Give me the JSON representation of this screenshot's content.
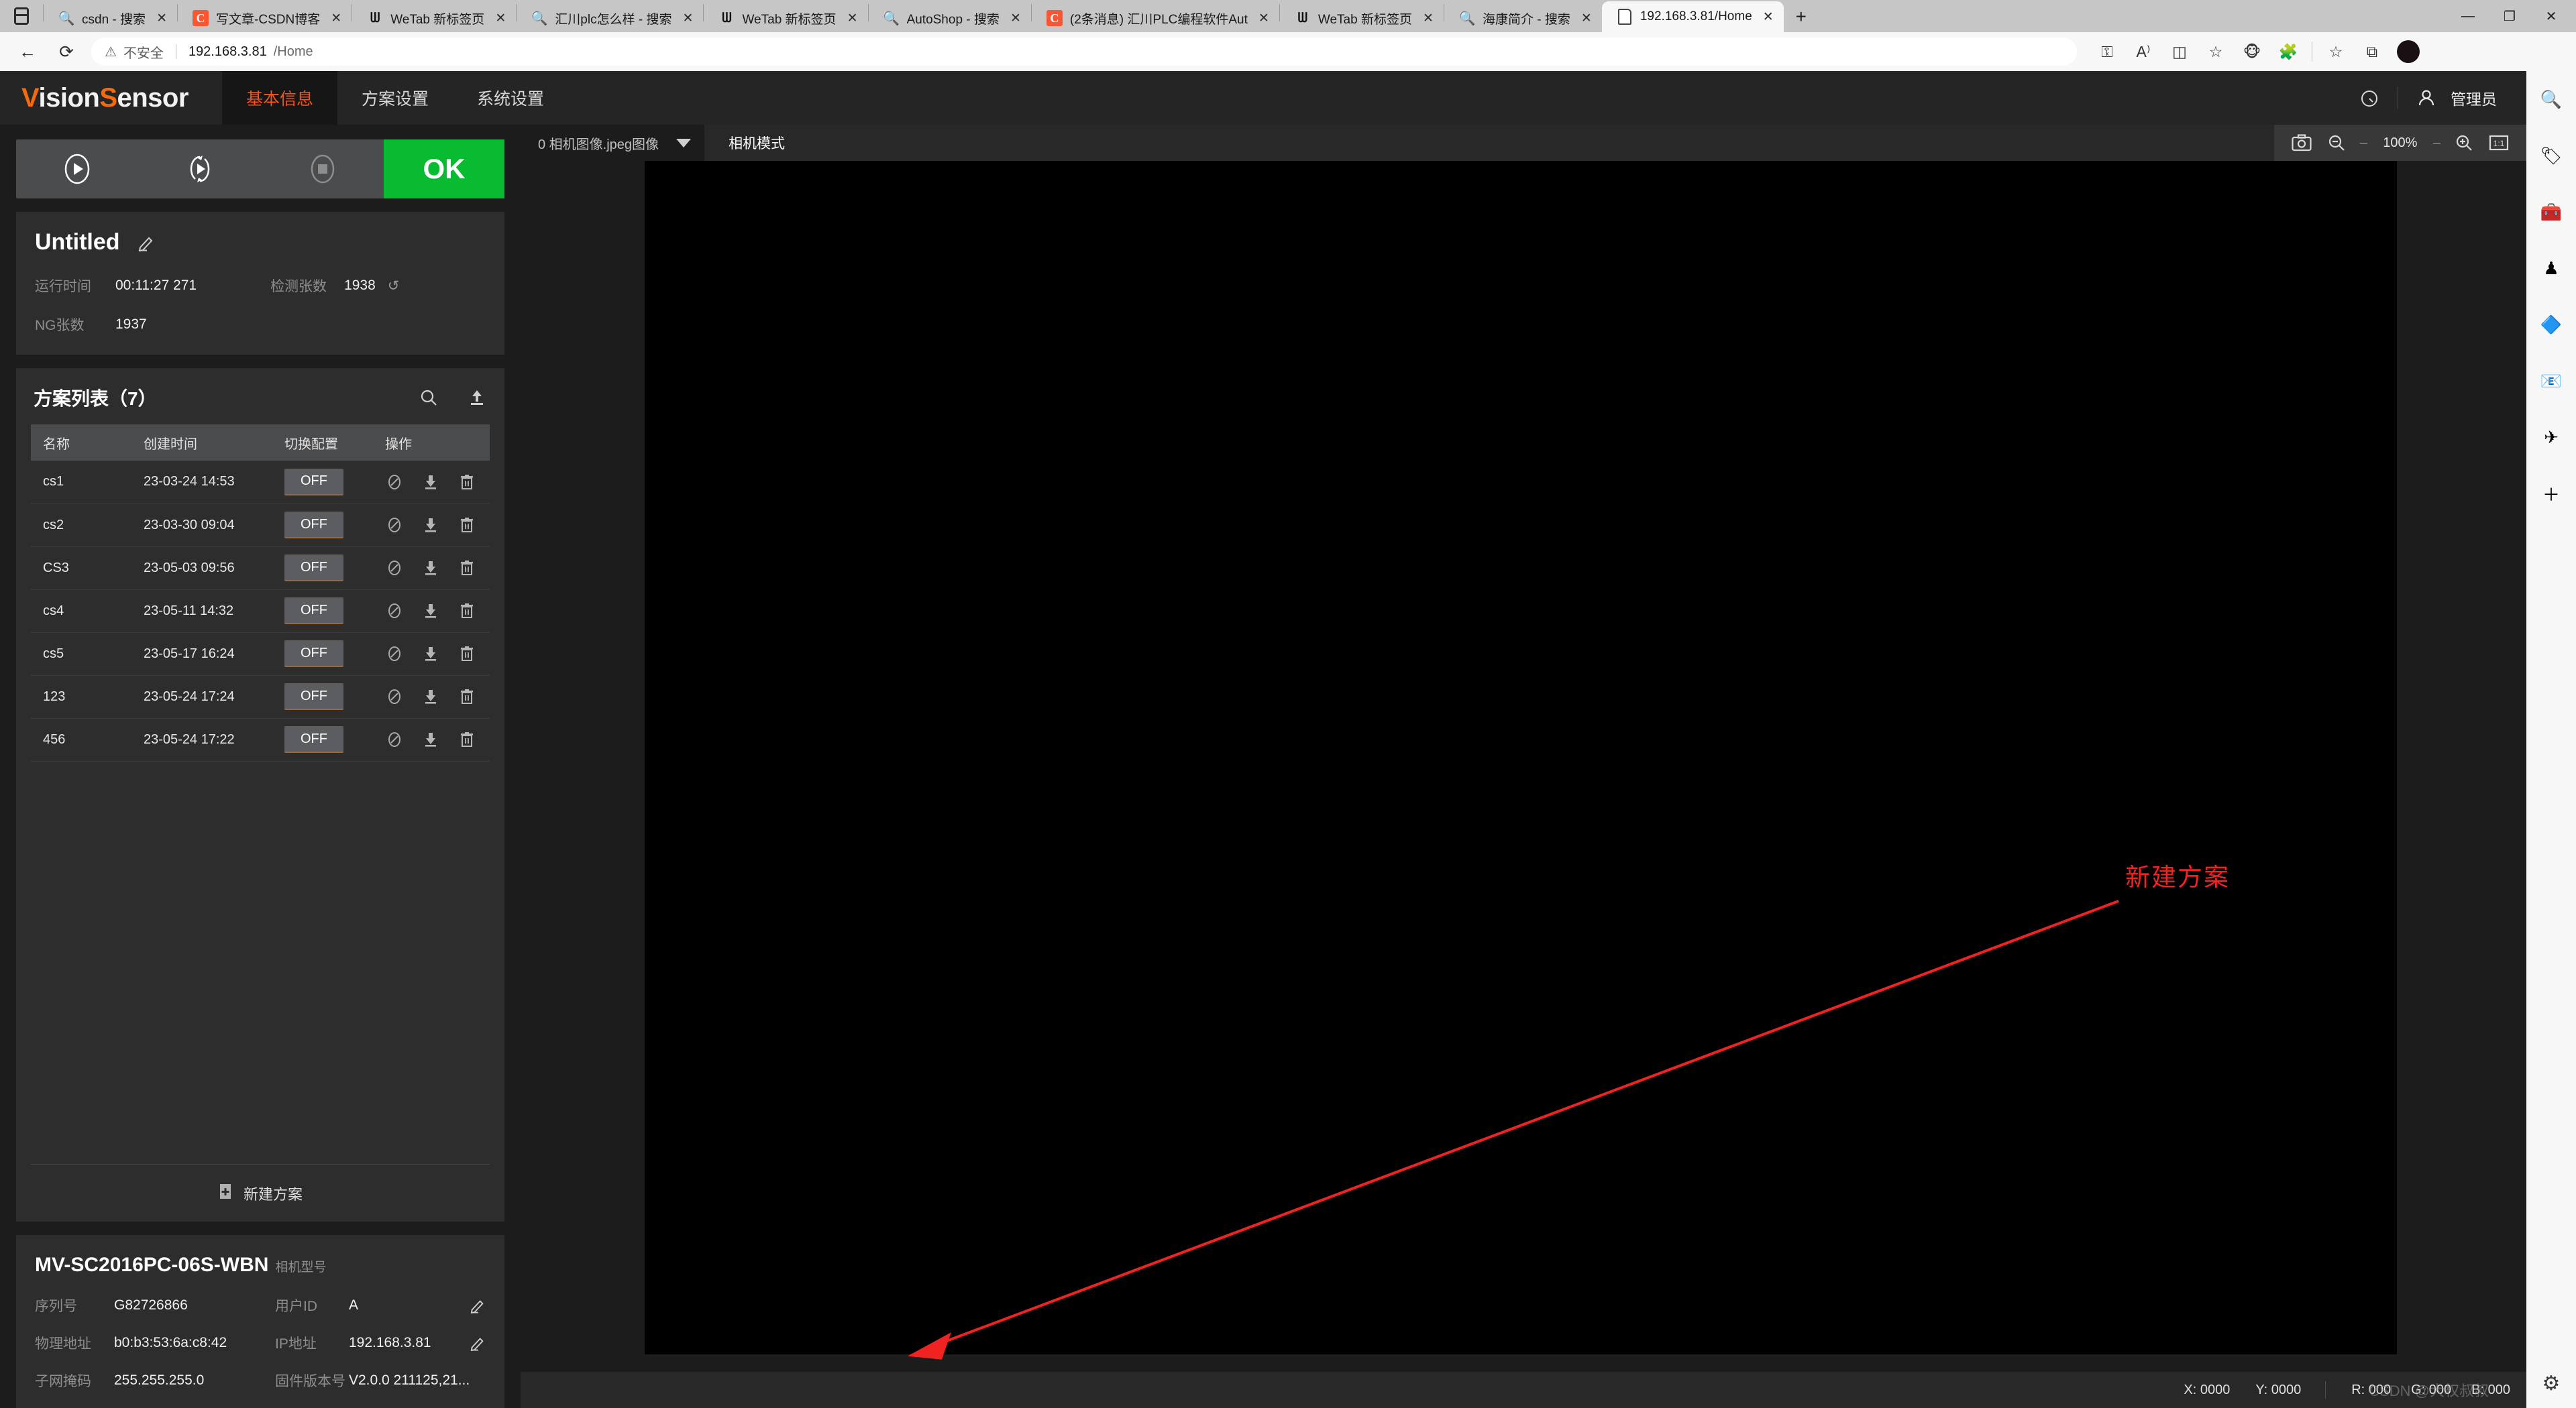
{
  "browser": {
    "tabs": [
      {
        "title": "csdn - 搜索",
        "favicon": "search-icon",
        "active": false
      },
      {
        "title": "写文章-CSDN博客",
        "favicon": "csdn-icon",
        "active": false
      },
      {
        "title": "WeTab 新标签页",
        "favicon": "wetab-icon",
        "active": false
      },
      {
        "title": "汇川plc怎么样 - 搜索",
        "favicon": "search-icon",
        "active": false
      },
      {
        "title": "WeTab 新标签页",
        "favicon": "wetab-icon",
        "active": false
      },
      {
        "title": "AutoShop - 搜索",
        "favicon": "search-icon",
        "active": false
      },
      {
        "title": "(2条消息) 汇川PLC编程软件Aut",
        "favicon": "csdn-icon",
        "active": false
      },
      {
        "title": "WeTab 新标签页",
        "favicon": "wetab-icon",
        "active": false
      },
      {
        "title": "海康简介 - 搜索",
        "favicon": "search-icon",
        "active": false
      },
      {
        "title": "192.168.3.81/Home",
        "favicon": "page-icon",
        "active": true
      }
    ],
    "new_tab_label": "+",
    "window_controls": {
      "minimize": "—",
      "maximize": "❐",
      "close": "✕"
    },
    "toolbar": {
      "back": "←",
      "reload": "⟳",
      "security_label": "不安全",
      "url_host": "192.168.3.81",
      "url_path": "/Home",
      "icons": [
        "key-icon",
        "read-aloud-icon",
        "split-screen-icon",
        "add-favorite-icon",
        "monkey-extension-icon",
        "extensions-icon",
        "favorites-icon",
        "collections-icon",
        "profile-avatar"
      ]
    },
    "sidebar_icons": [
      "search-icon",
      "shopping-tag-icon",
      "tools-icon",
      "games-icon",
      "office-icon",
      "outlook-icon",
      "telegram-icon",
      "add-icon"
    ],
    "settings_fab": "gear-icon"
  },
  "app": {
    "logo": {
      "orange_v": "V",
      "white_ision": "ision",
      "orange_s": "S",
      "white_ensor": "ensor"
    },
    "nav_tabs": [
      {
        "label": "基本信息",
        "active": true
      },
      {
        "label": "方案设置",
        "active": false
      },
      {
        "label": "系统设置",
        "active": false
      }
    ],
    "header_right": {
      "gauge_icon": "gauge-icon",
      "user_icon": "user-icon",
      "user_label": "管理员"
    },
    "run_controls": {
      "single_run": "play-circle-icon",
      "continuous_run": "play-loop-icon",
      "stop": "stop-circle-icon",
      "status_label": "OK",
      "status_color": "#09bb31"
    },
    "info_card": {
      "title": "Untitled",
      "edit_icon": "pencil-icon",
      "runtime_label": "运行时间",
      "runtime_value": "00:11:27 271",
      "detect_label": "检测张数",
      "detect_value": "1938",
      "reset_icon": "reset-icon",
      "ng_label": "NG张数",
      "ng_value": "1937"
    },
    "scheme_list": {
      "title": "方案列表（7）",
      "search_icon": "search-icon",
      "import_icon": "upload-icon",
      "columns": [
        "名称",
        "创建时间",
        "切换配置",
        "操作"
      ],
      "rows": [
        {
          "name": "cs1",
          "created": "23-03-24 14:53",
          "switch": "OFF"
        },
        {
          "name": "cs2",
          "created": "23-03-30 09:04",
          "switch": "OFF"
        },
        {
          "name": "CS3",
          "created": "23-05-03 09:56",
          "switch": "OFF"
        },
        {
          "name": "cs4",
          "created": "23-05-11 14:32",
          "switch": "OFF"
        },
        {
          "name": "cs5",
          "created": "23-05-17 16:24",
          "switch": "OFF"
        },
        {
          "name": "123",
          "created": "23-05-24 17:24",
          "switch": "OFF"
        },
        {
          "name": "456",
          "created": "23-05-24 17:22",
          "switch": "OFF"
        }
      ],
      "row_action_icons": [
        "load-icon",
        "download-icon",
        "delete-icon"
      ],
      "new_button_label": "新建方案",
      "new_button_icon": "new-file-icon"
    },
    "device_card": {
      "model": "MV-SC2016PC-06S-WBN",
      "model_label": "相机型号",
      "serial_label": "序列号",
      "serial_value": "G82726866",
      "userid_label": "用户ID",
      "userid_value": "A",
      "mac_label": "物理地址",
      "mac_value": "b0:b3:53:6a:c8:42",
      "ip_label": "IP地址",
      "ip_value": "192.168.3.81",
      "mask_label": "子网掩码",
      "mask_value": "255.255.255.0",
      "fw_label": "固件版本号",
      "fw_value": "V2.0.0 211125,21...",
      "edit_icon": "pencil-icon"
    },
    "viewer": {
      "image_tab_label": "0 相机图像.jpeg图像",
      "dropdown_icon": "triangle-down-icon",
      "mode_label": "相机模式",
      "snapshot_icon": "camera-icon",
      "zoom_out_icon": "zoom-out-icon",
      "zoom_value": "100%",
      "zoom_in_icon": "zoom-in-icon",
      "fit_icon": "one-to-one-icon",
      "annotation": "新建方案",
      "annotation_color": "#f02222"
    },
    "status_bar": {
      "x_label": "X: 0000",
      "y_label": "Y: 0000",
      "r_label": "R: 000",
      "g_label": "G: 000",
      "b_label": "B: 000",
      "watermark": "CSDN @大权叔叔"
    }
  }
}
